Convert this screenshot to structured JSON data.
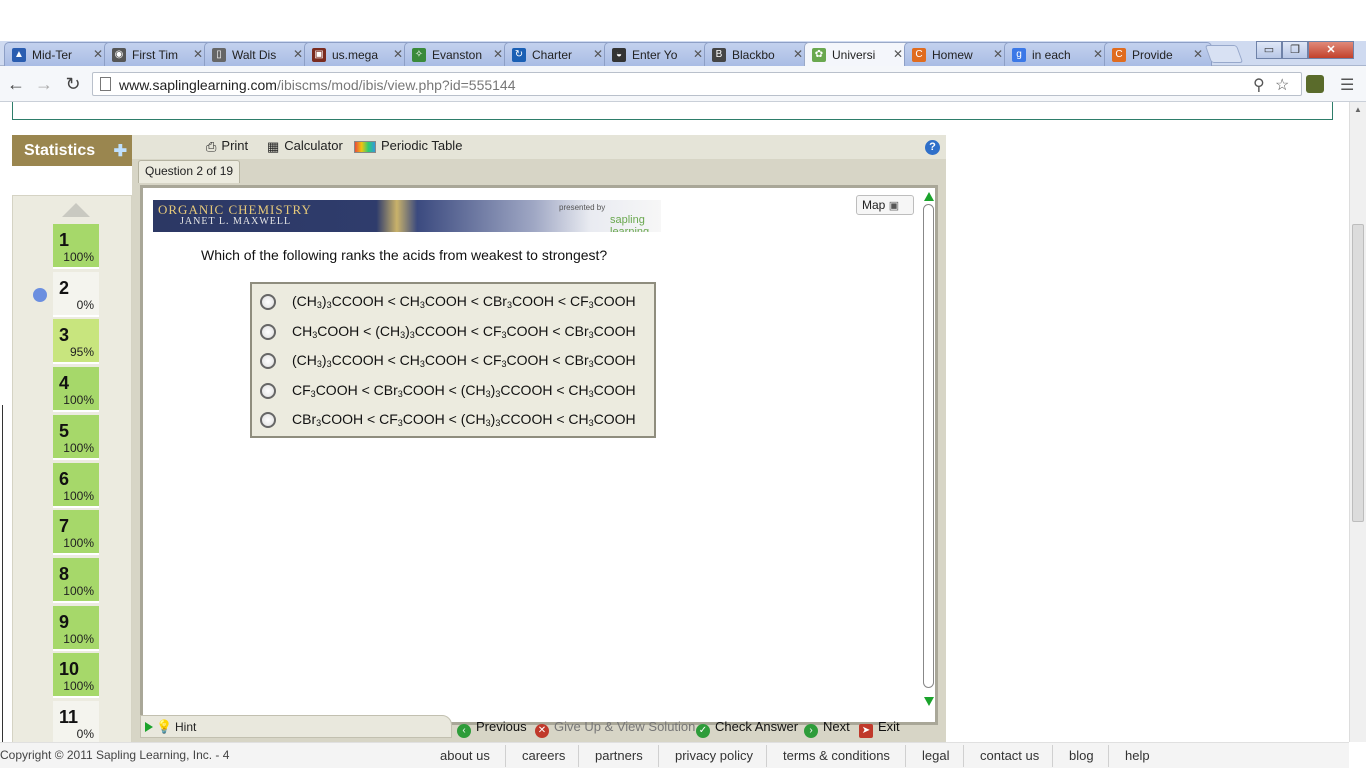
{
  "browser": {
    "tabs": [
      {
        "title": "Mid-Ter",
        "icon": "mountain-icon",
        "color": "#2a5db0"
      },
      {
        "title": "First Tim",
        "icon": "circle-logo-icon",
        "color": "#555555"
      },
      {
        "title": "Walt Dis",
        "icon": "document-icon",
        "color": "#666666"
      },
      {
        "title": "us.mega",
        "icon": "mega-icon",
        "color": "#7a2b1f"
      },
      {
        "title": "Evanston",
        "icon": "leaf-icon",
        "color": "#3a8a3a"
      },
      {
        "title": "Charter",
        "icon": "charter-icon",
        "color": "#1a5fb4"
      },
      {
        "title": "Enter Yo",
        "icon": "hat-icon",
        "color": "#333333"
      },
      {
        "title": "Blackbo",
        "icon": "blackboard-icon",
        "color": "#444444"
      },
      {
        "title": "Universi",
        "icon": "sapling-icon",
        "color": "#6aa84f",
        "active": true
      },
      {
        "title": "Homew",
        "icon": "chegg-icon",
        "color": "#e06c1f"
      },
      {
        "title": "in each",
        "icon": "google-icon",
        "color": "#3b78e7"
      },
      {
        "title": "Provide",
        "icon": "chegg-icon",
        "color": "#e06c1f"
      }
    ],
    "url_host": "www.saplinglearning.com",
    "url_path": "/ibiscms/mod/ibis/view.php?id=555144",
    "tab_close_glyph": "✕",
    "window_buttons": {
      "minimize": "▭",
      "maximize": "❐",
      "close": "✕"
    }
  },
  "sidebar": {
    "statistics_label": "Statistics",
    "questions": [
      {
        "number": "1",
        "score": "100%",
        "state": "full"
      },
      {
        "number": "2",
        "score": "0%",
        "state": "zero",
        "current": true
      },
      {
        "number": "3",
        "score": "95%",
        "state": "partial"
      },
      {
        "number": "4",
        "score": "100%",
        "state": "full"
      },
      {
        "number": "5",
        "score": "100%",
        "state": "full"
      },
      {
        "number": "6",
        "score": "100%",
        "state": "full"
      },
      {
        "number": "7",
        "score": "100%",
        "state": "full"
      },
      {
        "number": "8",
        "score": "100%",
        "state": "full"
      },
      {
        "number": "9",
        "score": "100%",
        "state": "full"
      },
      {
        "number": "10",
        "score": "100%",
        "state": "full"
      },
      {
        "number": "11",
        "score": "0%",
        "state": "zero"
      }
    ]
  },
  "frame_toolbar": {
    "print_label": "Print",
    "calculator_label": "Calculator",
    "periodic_table_label": "Periodic Table",
    "help_glyph": "?"
  },
  "question_tab": "Question 2 of 19",
  "banner": {
    "line1": "Organic Chemistry",
    "line2": "Janet L. Maxwell",
    "presented_by": "presented by",
    "brand": "sapling learning"
  },
  "map_label": "Map",
  "question_text": "Which of the following ranks the acids from weakest to strongest?",
  "choices": [
    {
      "parts": [
        "(CH",
        "3",
        ")",
        "3",
        "CCOOH < CH",
        "3",
        "COOH < CBr",
        "3",
        "COOH < CF",
        "3",
        "COOH"
      ]
    },
    {
      "parts": [
        "CH",
        "3",
        "COOH < (CH",
        "3",
        ")",
        "3",
        "CCOOH < CF",
        "3",
        "COOH < CBr",
        "3",
        "COOH"
      ]
    },
    {
      "parts": [
        "(CH",
        "3",
        ")",
        "3",
        "CCOOH < CH",
        "3",
        "COOH < CF",
        "3",
        "COOH < CBr",
        "3",
        "COOH"
      ]
    },
    {
      "parts": [
        "CF",
        "3",
        "COOH < CBr",
        "3",
        "COOH < (CH",
        "3",
        ")",
        "3",
        "CCOOH < CH",
        "3",
        "COOH"
      ]
    },
    {
      "parts": [
        "CBr",
        "3",
        "COOH < CF",
        "3",
        "COOH < (CH",
        "3",
        ")",
        "3",
        "CCOOH < CH",
        "3",
        "COOH"
      ]
    }
  ],
  "actions": {
    "hint": "Hint",
    "previous": "Previous",
    "give_up": "Give Up & View Solution",
    "check_answer": "Check Answer",
    "next": "Next",
    "exit": "Exit"
  },
  "footer": {
    "copyright": "Copyright © 2011 Sapling Learning, Inc. - 4",
    "links": [
      "about us",
      "careers",
      "partners",
      "privacy policy",
      "terms & conditions",
      "legal",
      "contact us",
      "blog",
      "help"
    ]
  },
  "colors": {
    "score_full": "#a6d86a",
    "score_partial": "#c8e57e",
    "score_zero": "#f4f4ee",
    "statistics_bg": "#9a864f",
    "current_dot": "#6b8fe0",
    "accent_green": "#1aa32b"
  }
}
